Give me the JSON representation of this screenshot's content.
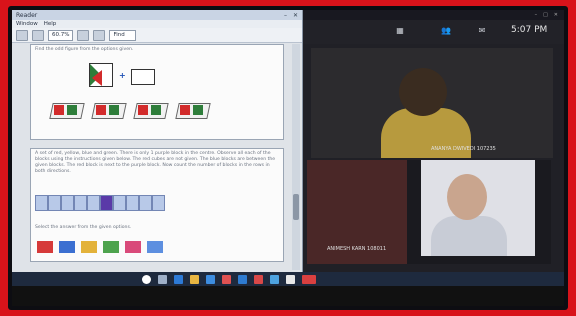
{
  "pdf_window": {
    "title": "Reader",
    "menu": [
      "Window",
      "Help"
    ],
    "zoom": "60.7%",
    "find_label": "Find",
    "page1_text": "Find the odd figure from the options given.",
    "page2_text": "A set of red, yellow, blue and green. There is only 1 purple block in the centre. Observe all each of the blocks using the instructions given below. The red cubes are not given. The blue blocks are between the given blocks. The red block is next to the purple block. Now count the number of blocks in the rows in both directions.",
    "page2_text2": "Select the answer from the given options."
  },
  "call": {
    "time": "5:07 PM",
    "participant_a_name": "ANANYA DWIVEDI 107235",
    "participant_b_name": "ANIMESH KARN 108011"
  },
  "colors": {
    "frame": "#d8131a",
    "taskbar": "#1e2a3e"
  }
}
